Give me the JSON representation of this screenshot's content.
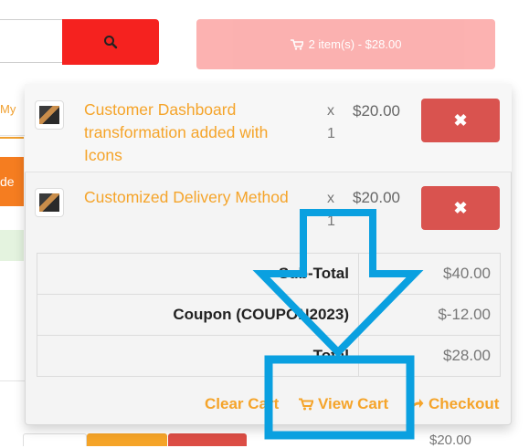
{
  "header": {
    "search_icon": "magnifier-icon",
    "cart_button_text": "2 item(s) - $28.00",
    "cart_icon": "shopping-cart-icon"
  },
  "background": {
    "tab_partial_label": "My",
    "orange_partial_label": "de W",
    "bottom_price_partial": "$20.00"
  },
  "cart": {
    "items": [
      {
        "name": "Customer Dashboard transformation added with Icons",
        "qty_x": "x",
        "qty": "1",
        "price": "$20.00",
        "remove_icon": "close-icon"
      },
      {
        "name": "Customized Delivery Method",
        "qty_x": "x",
        "qty": "1",
        "price": "$20.00",
        "remove_icon": "close-icon"
      }
    ],
    "totals": [
      {
        "label": "Sub-Total",
        "value": "$40.00"
      },
      {
        "label": "Coupon (COUPON2023)",
        "value": "$-12.00"
      },
      {
        "label": "Total",
        "value": "$28.00"
      }
    ],
    "actions": {
      "clear_cart": "Clear Cart",
      "view_cart": "View Cart",
      "checkout": "Checkout"
    }
  },
  "colors": {
    "accent": "#f5a42a",
    "header_red": "#f5221f",
    "remove_red": "#d9534f",
    "annotation_blue": "#0aa0e0"
  }
}
